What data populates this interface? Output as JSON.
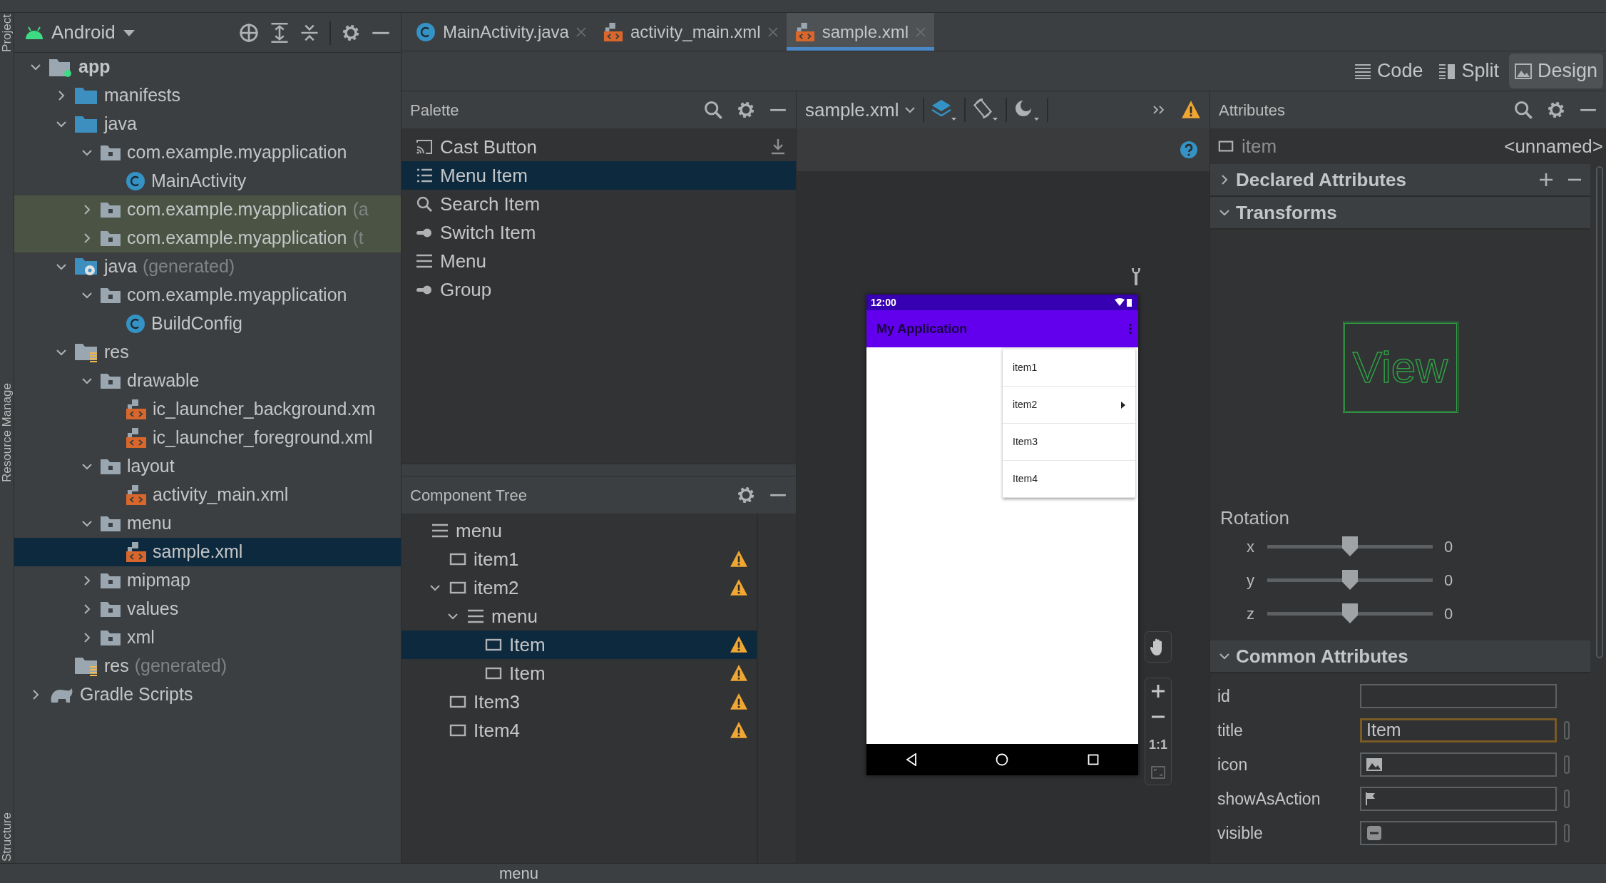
{
  "side_tabs": [
    "Project",
    "Resource Manage",
    "Structure"
  ],
  "project": {
    "view": "Android",
    "tree": [
      {
        "label": "app",
        "kind": "module",
        "expanded": true,
        "selected": false,
        "highlighted": false,
        "children": [
          {
            "label": "manifests",
            "kind": "bluefolder",
            "expanded": false,
            "selected": false,
            "highlighted": false
          },
          {
            "label": "java",
            "kind": "bluefolder",
            "expanded": true,
            "selected": false,
            "highlighted": false,
            "children": [
              {
                "label": "com.example.myapplication",
                "kind": "package",
                "expanded": true,
                "selected": false,
                "highlighted": false,
                "children": [
                  {
                    "label": "MainActivity",
                    "kind": "class",
                    "selected": false,
                    "highlighted": false
                  }
                ]
              },
              {
                "label": "com.example.myapplication",
                "note": "(a",
                "kind": "package",
                "expanded": false,
                "selected": false,
                "highlighted": true
              },
              {
                "label": "com.example.myapplication",
                "note": "(t",
                "kind": "package",
                "expanded": false,
                "selected": false,
                "highlighted": true
              }
            ]
          },
          {
            "label": "java",
            "note": "(generated)",
            "kind": "genfolder",
            "expanded": true,
            "selected": false,
            "highlighted": false,
            "children": [
              {
                "label": "com.example.myapplication",
                "kind": "package",
                "expanded": true,
                "selected": false,
                "highlighted": false,
                "children": [
                  {
                    "label": "BuildConfig",
                    "kind": "class",
                    "selected": false,
                    "highlighted": false
                  }
                ]
              }
            ]
          },
          {
            "label": "res",
            "kind": "resfolder",
            "expanded": true,
            "selected": false,
            "highlighted": false,
            "children": [
              {
                "label": "drawable",
                "kind": "package",
                "expanded": true,
                "selected": false,
                "highlighted": false,
                "children": [
                  {
                    "label": "ic_launcher_background.xm",
                    "kind": "xml",
                    "selected": false,
                    "highlighted": false
                  },
                  {
                    "label": "ic_launcher_foreground.xml",
                    "kind": "xml",
                    "selected": false,
                    "highlighted": false
                  }
                ]
              },
              {
                "label": "layout",
                "kind": "package",
                "expanded": true,
                "selected": false,
                "highlighted": false,
                "children": [
                  {
                    "label": "activity_main.xml",
                    "kind": "xml",
                    "selected": false,
                    "highlighted": false
                  }
                ]
              },
              {
                "label": "menu",
                "kind": "package",
                "expanded": true,
                "selected": false,
                "highlighted": false,
                "children": [
                  {
                    "label": "sample.xml",
                    "kind": "xml",
                    "selected": true,
                    "highlighted": false
                  }
                ]
              },
              {
                "label": "mipmap",
                "kind": "package",
                "expanded": false,
                "selected": false,
                "highlighted": false
              },
              {
                "label": "values",
                "kind": "package",
                "expanded": false,
                "selected": false,
                "highlighted": false
              },
              {
                "label": "xml",
                "kind": "package",
                "expanded": false,
                "selected": false,
                "highlighted": false
              }
            ]
          },
          {
            "label": "res",
            "note": "(generated)",
            "kind": "resfolder",
            "selected": false,
            "highlighted": false
          }
        ]
      },
      {
        "label": "Gradle Scripts",
        "kind": "gradle",
        "expanded": false,
        "selected": false,
        "highlighted": false
      }
    ]
  },
  "editor_tabs": [
    {
      "label": "MainActivity.java",
      "kind": "class",
      "selected": false
    },
    {
      "label": "activity_main.xml",
      "kind": "xml",
      "selected": false
    },
    {
      "label": "sample.xml",
      "kind": "xml",
      "selected": true
    }
  ],
  "view_modes": [
    {
      "label": "Code",
      "kind": "code",
      "selected": false
    },
    {
      "label": "Split",
      "kind": "split",
      "selected": false
    },
    {
      "label": "Design",
      "kind": "design",
      "selected": true
    }
  ],
  "palette": {
    "title": "Palette",
    "items": [
      {
        "label": "Cast Button",
        "kind": "cast",
        "selected": false,
        "download": true
      },
      {
        "label": "Menu Item",
        "kind": "list",
        "selected": true,
        "download": false
      },
      {
        "label": "Search Item",
        "kind": "search",
        "selected": false,
        "download": false
      },
      {
        "label": "Switch Item",
        "kind": "switch",
        "selected": false,
        "download": false
      },
      {
        "label": "Menu",
        "kind": "menu",
        "selected": false,
        "download": false
      },
      {
        "label": "Group",
        "kind": "switch",
        "selected": false,
        "download": false
      }
    ]
  },
  "component_tree": {
    "title": "Component Tree",
    "items": [
      {
        "label": "menu",
        "kind": "menu",
        "warning": false,
        "selected": false,
        "children": [
          {
            "label": "item1",
            "kind": "item",
            "warning": true,
            "selected": false
          },
          {
            "label": "item2",
            "kind": "item",
            "warning": true,
            "selected": false,
            "expanded": true,
            "children": [
              {
                "label": "menu",
                "kind": "menu",
                "warning": false,
                "selected": false,
                "expanded": true,
                "children": [
                  {
                    "label": "Item",
                    "kind": "item",
                    "warning": true,
                    "selected": true
                  },
                  {
                    "label": "Item",
                    "kind": "item",
                    "warning": true,
                    "selected": false
                  }
                ]
              }
            ]
          },
          {
            "label": "Item3",
            "kind": "item",
            "warning": true,
            "selected": false
          },
          {
            "label": "Item4",
            "kind": "item",
            "warning": true,
            "selected": false
          }
        ]
      }
    ]
  },
  "design_toolbar": {
    "file": "sample.xml",
    "warning": true
  },
  "phone": {
    "time": "12:00",
    "app_title": "My Application",
    "menu": [
      {
        "label": "item1",
        "submenu": false
      },
      {
        "label": "item2",
        "submenu": true
      },
      {
        "label": "Item3",
        "submenu": false
      },
      {
        "label": "Item4",
        "submenu": false
      }
    ]
  },
  "zoom_controls": {
    "actual_size": "1:1"
  },
  "attributes": {
    "title": "Attributes",
    "component": {
      "type": "item",
      "name": "<unnamed>"
    },
    "declared": {
      "label": "Declared Attributes",
      "expanded": false
    },
    "transforms": {
      "label": "Transforms",
      "expanded": true,
      "preview": "View",
      "rotation_label": "Rotation",
      "axes": [
        {
          "axis": "x",
          "level": 0.5,
          "value": "0"
        },
        {
          "axis": "y",
          "level": 0.5,
          "value": "0"
        },
        {
          "axis": "z",
          "level": 0.5,
          "value": "0"
        }
      ]
    },
    "common": {
      "label": "Common Attributes",
      "expanded": true,
      "fields": [
        {
          "label": "id",
          "kind": "text",
          "focused": false,
          "picker": false
        },
        {
          "label": "title",
          "kind": "text",
          "value": "Item",
          "focused": true,
          "picker": true
        },
        {
          "label": "icon",
          "kind": "image",
          "focused": false,
          "picker": true
        },
        {
          "label": "showAsAction",
          "kind": "flag",
          "focused": false,
          "picker": true
        },
        {
          "label": "visible",
          "kind": "toggle",
          "focused": false,
          "picker": true
        }
      ]
    }
  },
  "status_bar": {
    "breadcrumb": "menu"
  }
}
